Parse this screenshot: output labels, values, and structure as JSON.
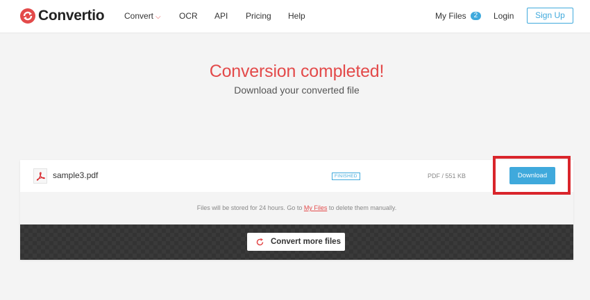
{
  "brand": {
    "name": "Convertio",
    "accent": "#e34a4a"
  },
  "nav": {
    "convert": "Convert",
    "ocr": "OCR",
    "api": "API",
    "pricing": "Pricing",
    "help": "Help",
    "my_files": "My Files",
    "my_files_count": "2",
    "login": "Login",
    "signup": "Sign Up"
  },
  "hero": {
    "title": "Conversion completed!",
    "subtitle": "Download your converted file"
  },
  "file": {
    "name": "sample3.pdf",
    "status": "FINISHED",
    "meta": "PDF / 551 KB",
    "download_label": "Download",
    "icon": "pdf-icon"
  },
  "storage": {
    "prefix": "Files will be stored for 24 hours. Go to ",
    "link": "My Files",
    "suffix": " to delete them manually."
  },
  "actions": {
    "convert_more": "Convert more files",
    "convert_more_icon": "refresh-icon"
  },
  "colors": {
    "primary_blue": "#3fa9dc",
    "highlight_red": "#d9252b"
  }
}
